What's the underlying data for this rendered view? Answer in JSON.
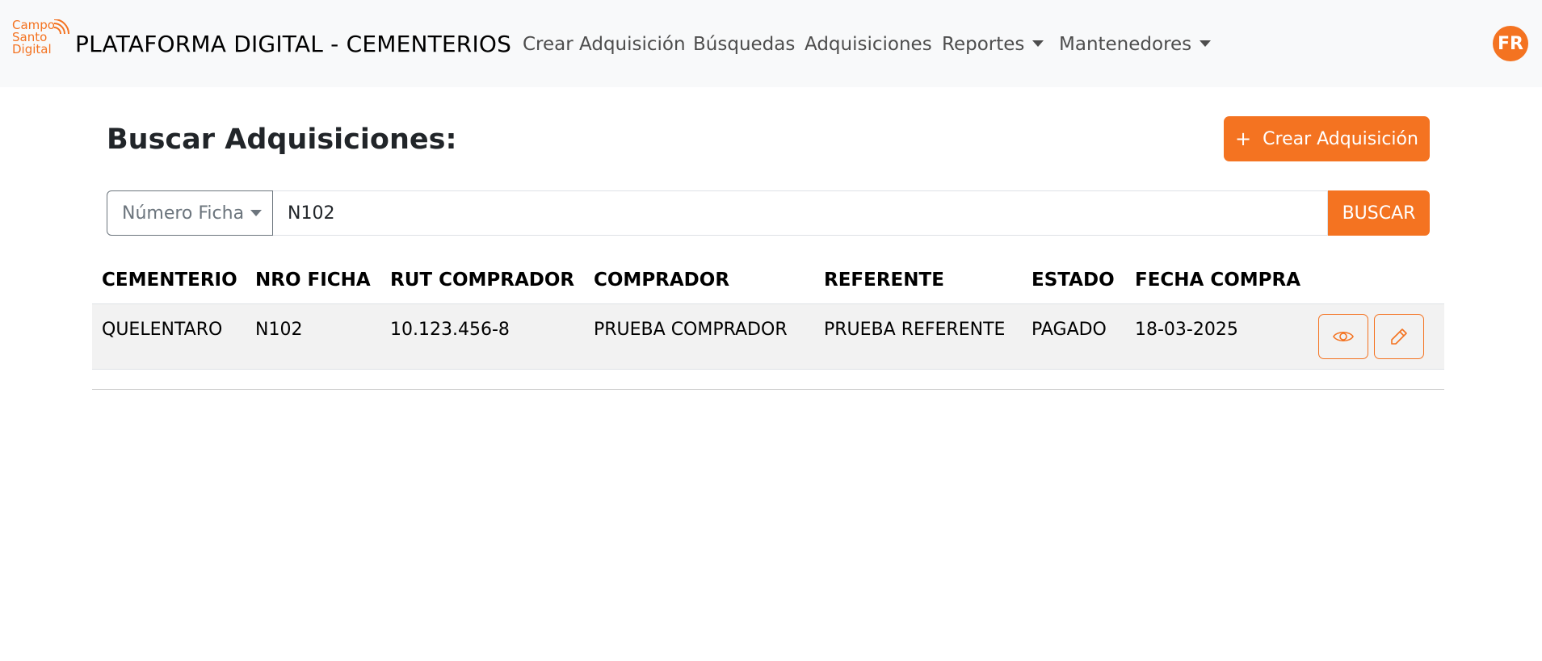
{
  "navbar": {
    "logo_lines": [
      "Campo",
      "Santo",
      "Digital"
    ],
    "brand": "PLATAFORMA DIGITAL - CEMENTERIOS",
    "links": [
      {
        "label": "Crear Adquisición",
        "dropdown": false
      },
      {
        "label": "Búsquedas",
        "dropdown": false
      },
      {
        "label": "Adquisiciones",
        "dropdown": false
      },
      {
        "label": "Reportes",
        "dropdown": true
      },
      {
        "label": "Mantenedores",
        "dropdown": true
      }
    ],
    "avatar_initials": "FR"
  },
  "main": {
    "title": "Buscar Adquisiciones:",
    "create_button": {
      "icon": "plus",
      "label": "Crear Adquisición"
    }
  },
  "search": {
    "filter_selected": "Número Ficha",
    "query": "N102",
    "button_label": "BUSCAR"
  },
  "table": {
    "headers": [
      "CEMENTERIO",
      "NRO FICHA",
      "RUT COMPRADOR",
      "COMPRADOR",
      "REFERENTE",
      "ESTADO",
      "FECHA COMPRA"
    ],
    "rows": [
      {
        "cells": [
          "QUELENTARO",
          "N102",
          "10.123.456-8",
          "PRUEBA COMPRADOR",
          "PRUEBA REFERENTE",
          "PAGADO",
          "18-03-2025"
        ],
        "actions": [
          "eye-icon",
          "pencil-icon"
        ]
      }
    ]
  },
  "colors": {
    "accent": "#f47321",
    "navbar_bg": "#f8f9fa",
    "row_bg": "#f2f2f2"
  }
}
